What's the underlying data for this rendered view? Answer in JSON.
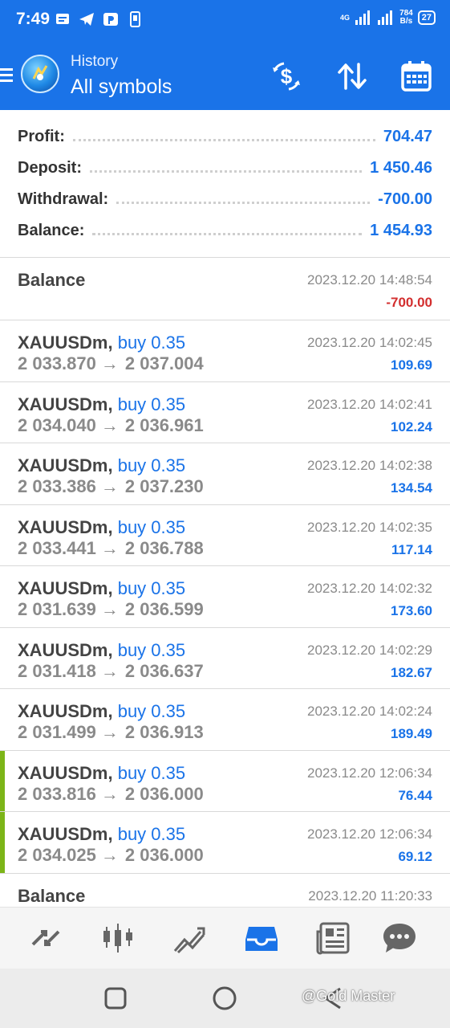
{
  "status_bar": {
    "time": "7:49",
    "network": "4G",
    "speed_value": "784",
    "speed_unit": "B/s",
    "battery": "27",
    "left_icons": [
      "message-icon",
      "telegram-icon",
      "app-p-icon",
      "phone-icon"
    ]
  },
  "app_bar": {
    "section": "History",
    "title": "All symbols",
    "actions": [
      "dollar-exchange-icon",
      "sort-icon",
      "calendar-icon"
    ]
  },
  "summary": [
    {
      "label": "Profit:",
      "value": "704.47"
    },
    {
      "label": "Deposit:",
      "value": "1 450.46"
    },
    {
      "label": "Withdrawal:",
      "value": "-700.00"
    },
    {
      "label": "Balance:",
      "value": "1 454.93"
    }
  ],
  "balance_ops": [
    {
      "title": "Balance",
      "datetime": "2023.12.20 14:48:54",
      "amount": "-700.00"
    },
    {
      "title": "Balance",
      "datetime": "2023.12.20 11:20:33"
    }
  ],
  "deals": [
    {
      "symbol": "XAUUSDm,",
      "side": "buy 0.35",
      "open": "2 033.870",
      "close": "2 037.004",
      "datetime": "2023.12.20 14:02:45",
      "profit": "109.69"
    },
    {
      "symbol": "XAUUSDm,",
      "side": "buy 0.35",
      "open": "2 034.040",
      "close": "2 036.961",
      "datetime": "2023.12.20 14:02:41",
      "profit": "102.24"
    },
    {
      "symbol": "XAUUSDm,",
      "side": "buy 0.35",
      "open": "2 033.386",
      "close": "2 037.230",
      "datetime": "2023.12.20 14:02:38",
      "profit": "134.54"
    },
    {
      "symbol": "XAUUSDm,",
      "side": "buy 0.35",
      "open": "2 033.441",
      "close": "2 036.788",
      "datetime": "2023.12.20 14:02:35",
      "profit": "117.14"
    },
    {
      "symbol": "XAUUSDm,",
      "side": "buy 0.35",
      "open": "2 031.639",
      "close": "2 036.599",
      "datetime": "2023.12.20 14:02:32",
      "profit": "173.60"
    },
    {
      "symbol": "XAUUSDm,",
      "side": "buy 0.35",
      "open": "2 031.418",
      "close": "2 036.637",
      "datetime": "2023.12.20 14:02:29",
      "profit": "182.67"
    },
    {
      "symbol": "XAUUSDm,",
      "side": "buy 0.35",
      "open": "2 031.499",
      "close": "2 036.913",
      "datetime": "2023.12.20 14:02:24",
      "profit": "189.49"
    },
    {
      "symbol": "XAUUSDm,",
      "side": "buy 0.35",
      "open": "2 033.816",
      "close": "2 036.000",
      "datetime": "2023.12.20 12:06:34",
      "profit": "76.44"
    },
    {
      "symbol": "XAUUSDm,",
      "side": "buy 0.35",
      "open": "2 034.025",
      "close": "2 036.000",
      "datetime": "2023.12.20 12:06:34",
      "profit": "69.12"
    }
  ],
  "deal_arrow": "→",
  "bottom_nav": [
    "quotes-icon",
    "chart-icon",
    "trade-icon",
    "history-icon",
    "news-icon",
    "chat-icon"
  ],
  "active_tab": "history-icon",
  "colors": {
    "accent": "#1a73e8",
    "negative": "#d32f2f",
    "tp_marker": "#7cb518"
  },
  "watermark": "@Gold Master"
}
